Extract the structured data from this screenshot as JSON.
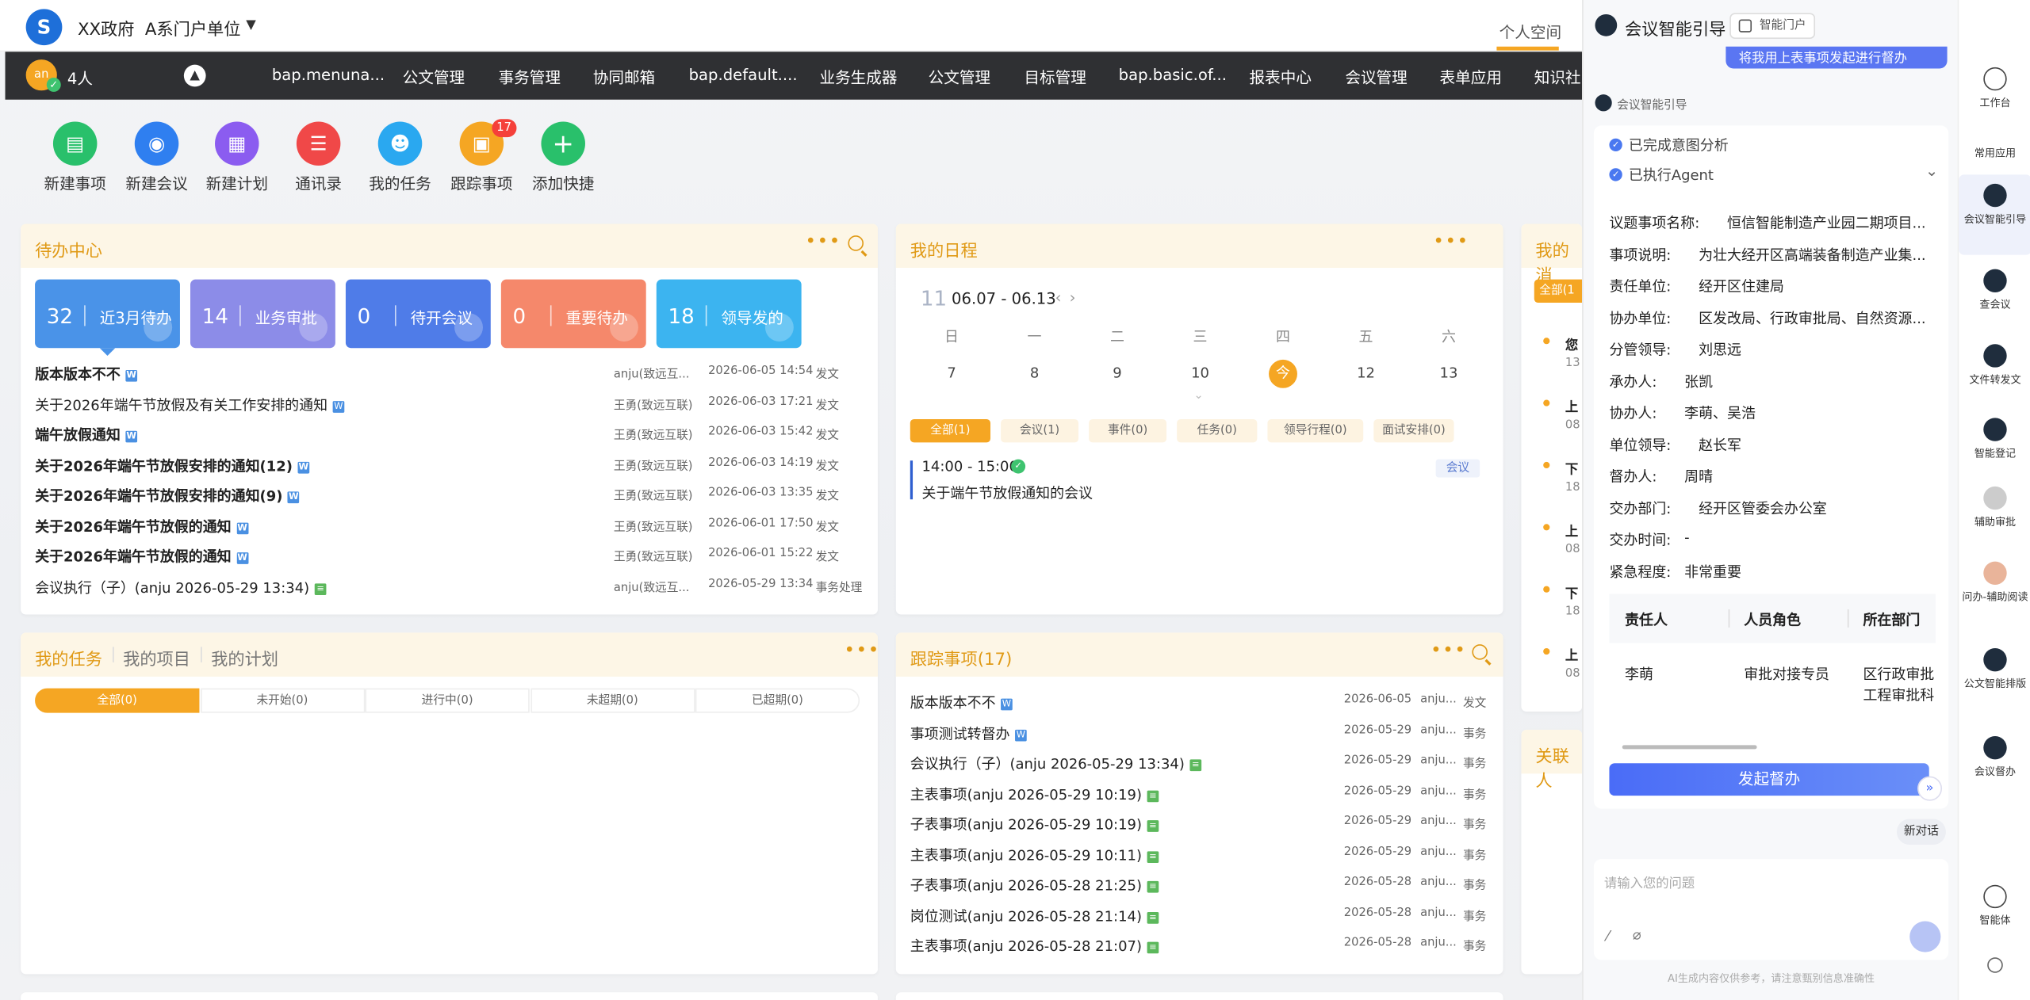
{
  "top": {
    "org": "XX政府",
    "unit": "A系门户单位",
    "personal_tab": "个人空间"
  },
  "nav": {
    "online_count": "4人",
    "avatar_text": "an",
    "items": [
      "bap.menuna...",
      "公文管理",
      "事务管理",
      "协同邮箱",
      "bap.default....",
      "业务生成器",
      "公文管理",
      "目标管理",
      "bap.basic.of...",
      "报表中心",
      "会议管理",
      "表单应用",
      "知识社"
    ]
  },
  "quick": [
    {
      "label": "新建事项",
      "icon": "new-item-icon",
      "color": "#29c06b"
    },
    {
      "label": "新建会议",
      "icon": "meeting-icon",
      "color": "#2f7ff0"
    },
    {
      "label": "新建计划",
      "icon": "plan-icon",
      "color": "#8b5cf0"
    },
    {
      "label": "通讯录",
      "icon": "contacts-icon",
      "color": "#f04848"
    },
    {
      "label": "我的任务",
      "icon": "task-icon",
      "color": "#2aa8f0"
    },
    {
      "label": "跟踪事项",
      "icon": "track-icon",
      "color": "#f5a623",
      "badge": "17"
    },
    {
      "label": "添加快捷",
      "icon": "plus-icon",
      "color": "#29c06b"
    }
  ],
  "todo": {
    "title": "待办中心",
    "tiles": [
      {
        "num": "32",
        "label": "近3月待办",
        "color": "#4a93e8"
      },
      {
        "num": "14",
        "label": "业务审批",
        "color": "#8c8ce8"
      },
      {
        "num": "0",
        "label": "待开会议",
        "color": "#4f7ce8"
      },
      {
        "num": "0",
        "label": "重要待办",
        "color": "#f5886b"
      },
      {
        "num": "18",
        "label": "领导发的",
        "color": "#3cb4f0"
      }
    ],
    "rows": [
      {
        "title": "版本版本不不",
        "bold": true,
        "icon": "w",
        "author": "anju(致远互...",
        "date": "2026-06-05 14:54",
        "kind": "发文"
      },
      {
        "title": "关于2026年端午节放假及有关工作安排的通知",
        "bold": false,
        "icon": "w",
        "author": "王勇(致远互联)",
        "date": "2026-06-03 17:21",
        "kind": "发文"
      },
      {
        "title": "端午放假通知",
        "bold": true,
        "icon": "w",
        "author": "王勇(致远互联)",
        "date": "2026-06-03 15:42",
        "kind": "发文"
      },
      {
        "title": "关于2026年端午节放假安排的通知(12)",
        "bold": true,
        "icon": "w",
        "author": "王勇(致远互联)",
        "date": "2026-06-03 14:19",
        "kind": "发文"
      },
      {
        "title": "关于2026年端午节放假安排的通知(9)",
        "bold": true,
        "icon": "w",
        "author": "王勇(致远互联)",
        "date": "2026-06-03 13:35",
        "kind": "发文"
      },
      {
        "title": "关于2026年端午节放假的通知",
        "bold": true,
        "icon": "w",
        "author": "王勇(致远互联)",
        "date": "2026-06-01 17:50",
        "kind": "发文"
      },
      {
        "title": "关于2026年端午节放假的通知",
        "bold": true,
        "icon": "w",
        "author": "王勇(致远互联)",
        "date": "2026-06-01 15:22",
        "kind": "发文"
      },
      {
        "title": "会议执行（子）(anju 2026-05-29 13:34)",
        "bold": false,
        "icon": "g",
        "author": "anju(致远互...",
        "date": "2026-05-29 13:34",
        "kind": "事务处理"
      }
    ]
  },
  "schedule": {
    "title": "我的日程",
    "week_num": "11",
    "range": "06.07 - 06.13",
    "weekdays": [
      "日",
      "一",
      "二",
      "三",
      "四",
      "五",
      "六"
    ],
    "days": [
      "7",
      "8",
      "9",
      "10",
      "今",
      "12",
      "13"
    ],
    "filters": [
      "全部(1)",
      "会议(1)",
      "事件(0)",
      "任务(0)",
      "领导行程(0)",
      "面试安排(0)"
    ],
    "event_time": "14:00 - 15:00",
    "event_title": "关于端午节放假通知的会议",
    "event_tag": "会议"
  },
  "mytask": {
    "tabs": [
      "我的任务",
      "我的项目",
      "我的计划"
    ],
    "segments": [
      "全部(0)",
      "未开始(0)",
      "进行中(0)",
      "未超期(0)",
      "已超期(0)"
    ]
  },
  "tracking": {
    "title": "跟踪事项(17)",
    "rows": [
      {
        "title": "版本版本不不",
        "icon": "w",
        "date": "2026-06-05",
        "author": "anju...",
        "kind": "发文"
      },
      {
        "title": "事项测试转督办",
        "icon": "w",
        "date": "2026-05-29",
        "author": "anju...",
        "kind": "事务"
      },
      {
        "title": "会议执行（子）(anju 2026-05-29 13:34)",
        "icon": "g",
        "date": "2026-05-29",
        "author": "anju...",
        "kind": "事务"
      },
      {
        "title": "主表事项(anju 2026-05-29 10:19)",
        "icon": "g",
        "date": "2026-05-29",
        "author": "anju...",
        "kind": "事务"
      },
      {
        "title": "子表事项(anju 2026-05-29 10:19)",
        "icon": "g",
        "date": "2026-05-29",
        "author": "anju...",
        "kind": "事务"
      },
      {
        "title": "主表事项(anju 2026-05-29 10:11)",
        "icon": "g",
        "date": "2026-05-29",
        "author": "anju...",
        "kind": "事务"
      },
      {
        "title": "子表事项(anju 2026-05-28 21:25)",
        "icon": "g",
        "date": "2026-05-28",
        "author": "anju...",
        "kind": "事务"
      },
      {
        "title": "岗位测试(anju 2026-05-28 21:14)",
        "icon": "g",
        "date": "2026-05-28",
        "author": "anju...",
        "kind": "事务"
      },
      {
        "title": "主表事项(anju 2026-05-28 21:07)",
        "icon": "g",
        "date": "2026-05-28",
        "author": "anju...",
        "kind": "事务"
      }
    ]
  },
  "partial": {
    "msg_title": "我的消",
    "msg_chip": "全部(1",
    "msg_items": [
      {
        "t": "您",
        "d": "13"
      },
      {
        "t": "上",
        "d": "08"
      },
      {
        "t": "下",
        "d": "18"
      },
      {
        "t": "上",
        "d": "08"
      },
      {
        "t": "下",
        "d": "18"
      },
      {
        "t": "上",
        "d": "08"
      }
    ],
    "related_title": "关联人"
  },
  "assistant": {
    "title": "会议智能引导",
    "portal_btn": "智能门户",
    "user_msg": "将我用上表事项发起进行督办",
    "bot_name": "会议智能引导",
    "step1": "已完成意图分析",
    "step2": "已执行Agent",
    "fields": [
      {
        "k": "议题事项名称:",
        "v": "恒信智能制造产业园二期项目..."
      },
      {
        "k": "事项说明:",
        "v": "为壮大经开区高端装备制造产业集..."
      },
      {
        "k": "责任单位:",
        "v": "经开区住建局"
      },
      {
        "k": "协办单位:",
        "v": "区发改局、行政审批局、自然资源..."
      },
      {
        "k": "分管领导:",
        "v": "刘思远"
      },
      {
        "k": "承办人:",
        "v": "张凯"
      },
      {
        "k": "协办人:",
        "v": "李萌、吴浩"
      },
      {
        "k": "单位领导:",
        "v": "赵长军"
      },
      {
        "k": "督办人:",
        "v": "周晴"
      },
      {
        "k": "交办部门:",
        "v": "经开区管委会办公室"
      },
      {
        "k": "交办时间:",
        "v": "-"
      },
      {
        "k": "紧急程度:",
        "v": "非常重要"
      }
    ],
    "table_headers": [
      "责任人",
      "人员角色",
      "所在部门"
    ],
    "table_row": [
      "李萌",
      "审批对接专员",
      "区行政审批",
      "工程审批科"
    ],
    "action_btn": "发起督办",
    "new_chat": "新对话",
    "input_placeholder": "请输入您的问题",
    "disclaimer": "AI生成内容仅供参考，请注意甄别信息准确性"
  },
  "rail": {
    "items": [
      {
        "label": "工作台",
        "icon": "workbench-icon"
      },
      {
        "label": "常用应用",
        "icon": ""
      },
      {
        "label": "会议智能引导",
        "icon": "meeting-guide-icon",
        "active": true
      },
      {
        "label": "查会议",
        "icon": "search-meeting-icon"
      },
      {
        "label": "文件转发文",
        "icon": "file-convert-icon"
      },
      {
        "label": "智能登记",
        "icon": "smart-register-icon"
      },
      {
        "label": "辅助审批",
        "icon": "assist-approve-icon"
      },
      {
        "label": "问办-辅助阅读",
        "icon": "assist-read-icon"
      },
      {
        "label": "公文智能排版",
        "icon": "doc-layout-icon"
      },
      {
        "label": "会议督办",
        "icon": "meeting-supervise-icon"
      },
      {
        "label": "智能体",
        "icon": "agent-icon"
      }
    ]
  }
}
